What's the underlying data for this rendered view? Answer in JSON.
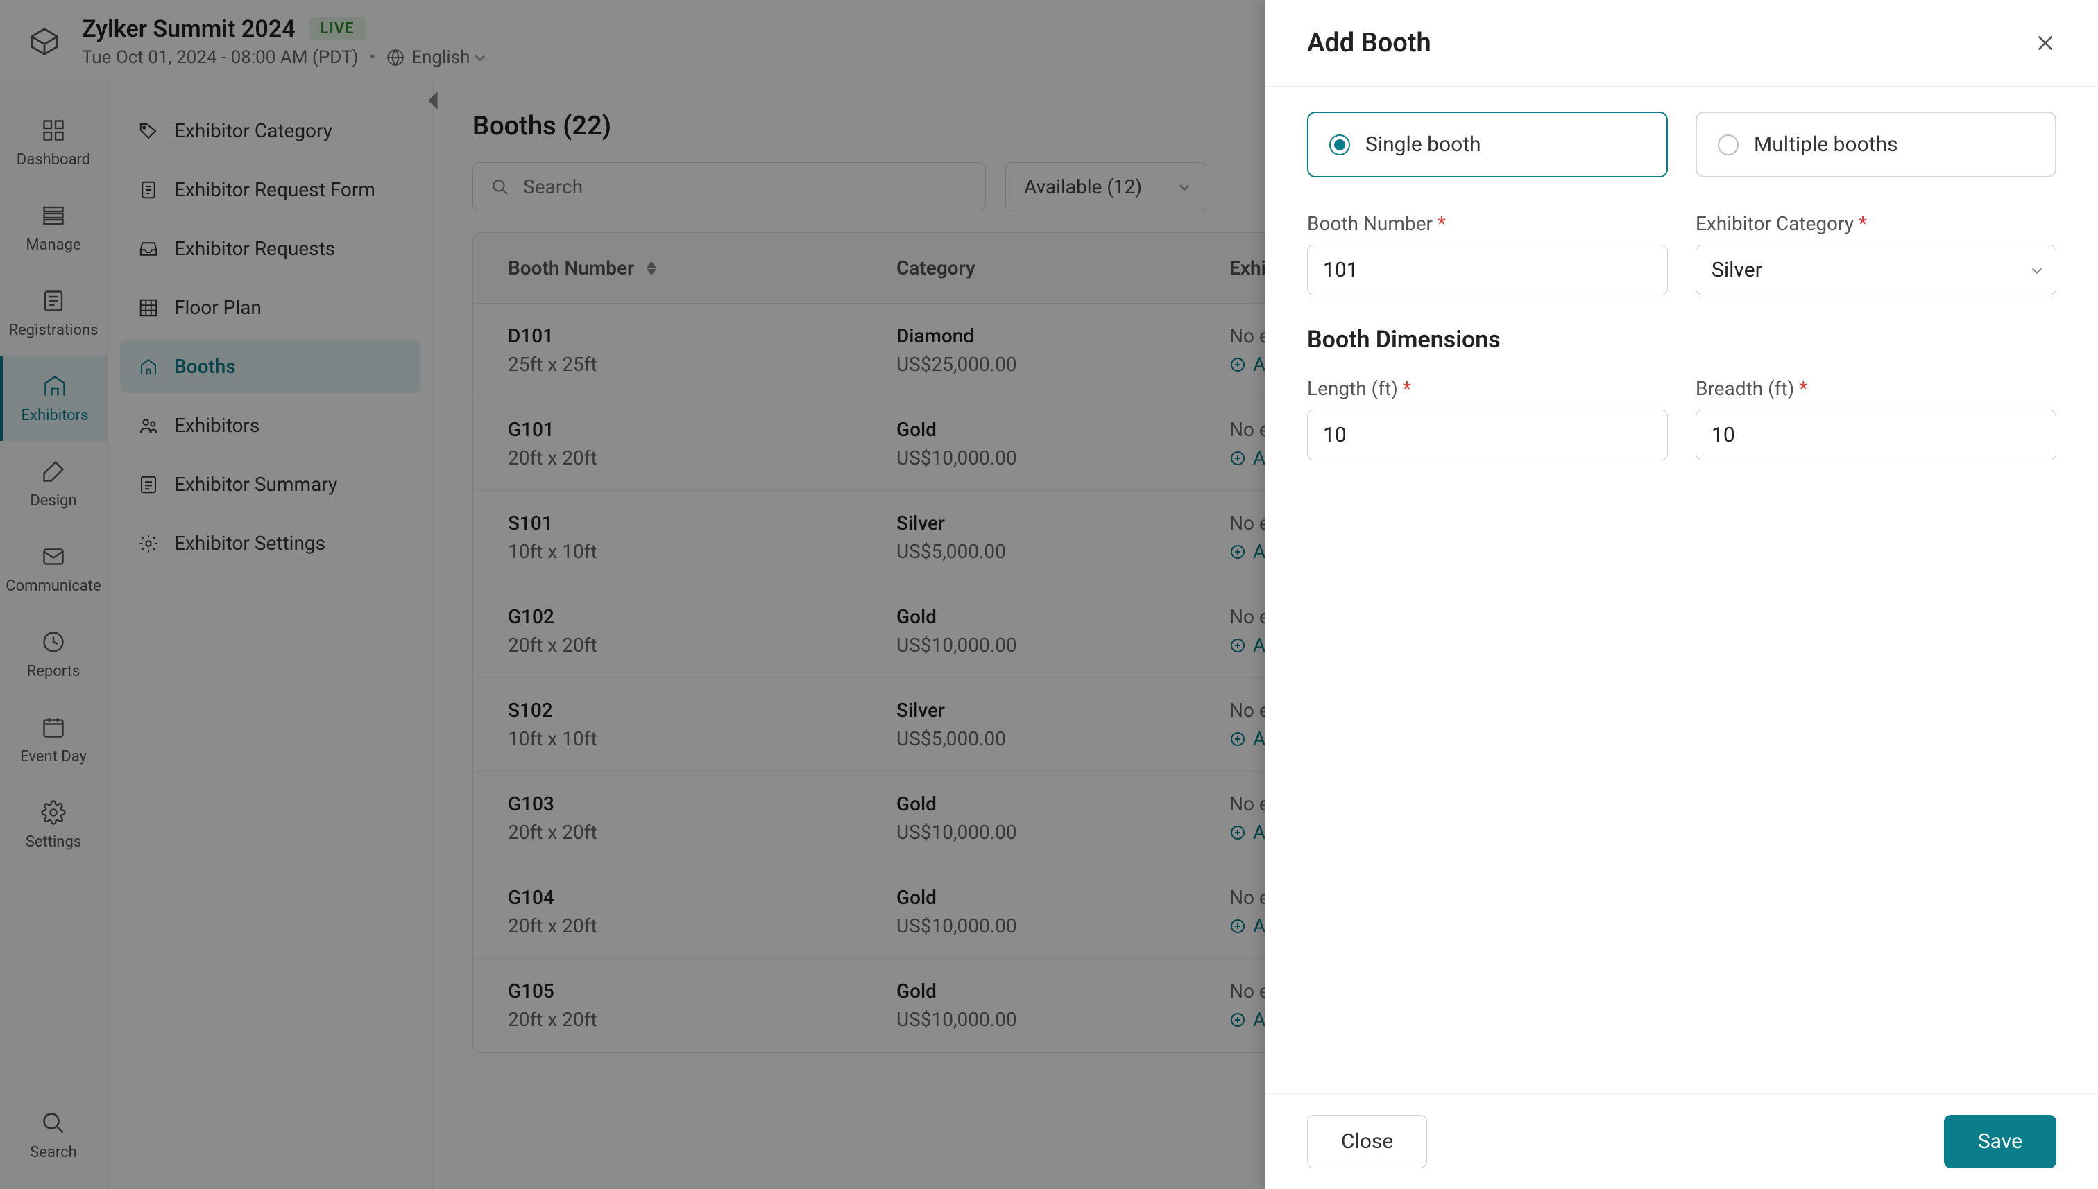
{
  "header": {
    "event_title": "Zylker Summit 2024",
    "live_badge": "LIVE",
    "datetime": "Tue Oct 01, 2024 - 08:00 AM (PDT)",
    "language": "English"
  },
  "leftnav": {
    "items": [
      {
        "key": "dashboard",
        "label": "Dashboard",
        "icon": "dashboard-icon"
      },
      {
        "key": "manage",
        "label": "Manage",
        "icon": "manage-icon"
      },
      {
        "key": "registrations",
        "label": "Registrations",
        "icon": "registrations-icon"
      },
      {
        "key": "exhibitors",
        "label": "Exhibitors",
        "icon": "exhibitors-icon",
        "active": true
      },
      {
        "key": "design",
        "label": "Design",
        "icon": "design-icon"
      },
      {
        "key": "communicate",
        "label": "Communicate",
        "icon": "communicate-icon"
      },
      {
        "key": "reports",
        "label": "Reports",
        "icon": "reports-icon"
      },
      {
        "key": "event-day",
        "label": "Event Day",
        "icon": "event-day-icon"
      },
      {
        "key": "settings",
        "label": "Settings",
        "icon": "settings-icon"
      }
    ],
    "bottom": {
      "key": "search",
      "label": "Search",
      "icon": "search-icon"
    }
  },
  "sidepanel": {
    "items": [
      {
        "key": "exhibitor-category",
        "label": "Exhibitor Category",
        "icon": "tag-icon"
      },
      {
        "key": "exhibitor-request-form",
        "label": "Exhibitor Request Form",
        "icon": "form-icon"
      },
      {
        "key": "exhibitor-requests",
        "label": "Exhibitor Requests",
        "icon": "inbox-icon"
      },
      {
        "key": "floor-plan",
        "label": "Floor Plan",
        "icon": "grid-icon"
      },
      {
        "key": "booths",
        "label": "Booths",
        "icon": "booth-icon",
        "active": true
      },
      {
        "key": "exhibitors",
        "label": "Exhibitors",
        "icon": "people-icon"
      },
      {
        "key": "exhibitor-summary",
        "label": "Exhibitor Summary",
        "icon": "summary-icon"
      },
      {
        "key": "exhibitor-settings",
        "label": "Exhibitor Settings",
        "icon": "gear-icon"
      }
    ]
  },
  "content": {
    "page_title": "Booths (22)",
    "search_placeholder": "Search",
    "filter_selected": "Available (12)",
    "columns": {
      "booth_number": "Booth Number",
      "category": "Category",
      "exhibitor": "Exhibitor"
    },
    "no_exhibitor_text": "No exhibitor added",
    "add_exhibitor_text": "Add Exhibitor",
    "rows": [
      {
        "number": "D101",
        "dims": "25ft x 25ft",
        "category": "Diamond",
        "price": "US$25,000.00"
      },
      {
        "number": "G101",
        "dims": "20ft x 20ft",
        "category": "Gold",
        "price": "US$10,000.00"
      },
      {
        "number": "S101",
        "dims": "10ft x 10ft",
        "category": "Silver",
        "price": "US$5,000.00"
      },
      {
        "number": "G102",
        "dims": "20ft x 20ft",
        "category": "Gold",
        "price": "US$10,000.00"
      },
      {
        "number": "S102",
        "dims": "10ft x 10ft",
        "category": "Silver",
        "price": "US$5,000.00"
      },
      {
        "number": "G103",
        "dims": "20ft x 20ft",
        "category": "Gold",
        "price": "US$10,000.00"
      },
      {
        "number": "G104",
        "dims": "20ft x 20ft",
        "category": "Gold",
        "price": "US$10,000.00"
      },
      {
        "number": "G105",
        "dims": "20ft x 20ft",
        "category": "Gold",
        "price": "US$10,000.00"
      }
    ]
  },
  "slideover": {
    "title": "Add Booth",
    "close_button": "Close",
    "save_button": "Save",
    "booth_mode": {
      "single": "Single booth",
      "multiple": "Multiple booths"
    },
    "fields": {
      "booth_number_label": "Booth Number",
      "booth_number_value": "101",
      "exhibitor_category_label": "Exhibitor Category",
      "exhibitor_category_value": "Silver",
      "dimensions_heading": "Booth Dimensions",
      "length_label": "Length (ft)",
      "length_value": "10",
      "breadth_label": "Breadth (ft)",
      "breadth_value": "10"
    }
  },
  "colors": {
    "accent": "#0a7d8a",
    "live_bg": "#e3f6e3",
    "live_fg": "#2e8a2e"
  }
}
